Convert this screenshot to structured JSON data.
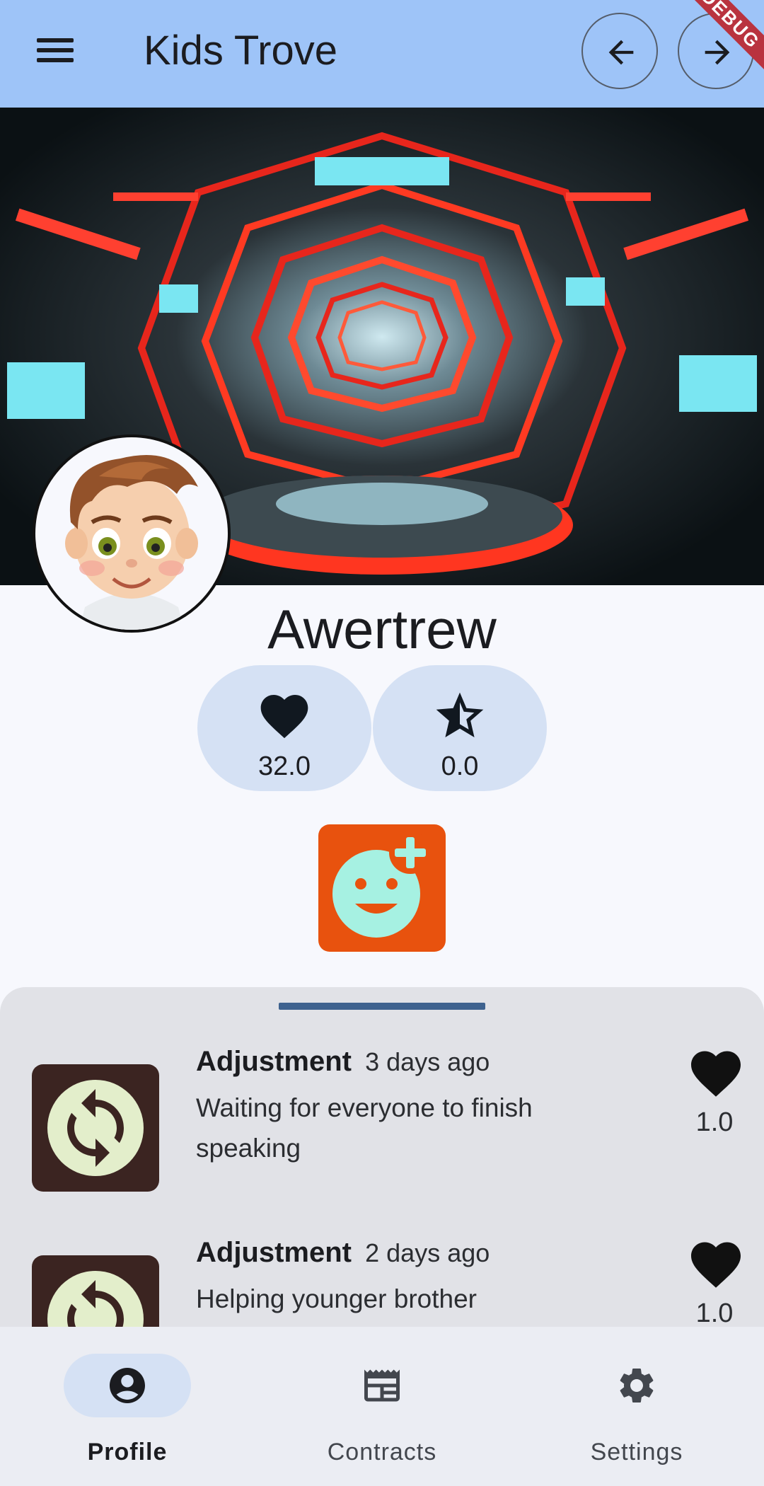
{
  "app": {
    "title": "Kids Trove",
    "debug_banner": "DEBUG"
  },
  "profile": {
    "name": "Awertrew",
    "hearts": "32.0",
    "stars": "0.0"
  },
  "entries": [
    {
      "type": "Adjustment",
      "time": "3 days ago",
      "description": "Waiting for everyone to finish speaking",
      "value": "1.0"
    },
    {
      "type": "Adjustment",
      "time": "2 days ago",
      "description": "Helping younger brother",
      "value": "1.0"
    }
  ],
  "bottom_nav": {
    "items": [
      {
        "label": "Profile",
        "icon": "account-circle-icon",
        "active": true
      },
      {
        "label": "Contracts",
        "icon": "newspaper-icon",
        "active": false
      },
      {
        "label": "Settings",
        "icon": "gear-icon",
        "active": false
      }
    ]
  },
  "colors": {
    "appbar": "#9ec4f8",
    "stat_pill": "#d5e1f4",
    "add_button": "#e8520e",
    "entry_icon_bg": "#3b2421",
    "sheet": "#e1e2e7",
    "handle": "#3e628f"
  }
}
